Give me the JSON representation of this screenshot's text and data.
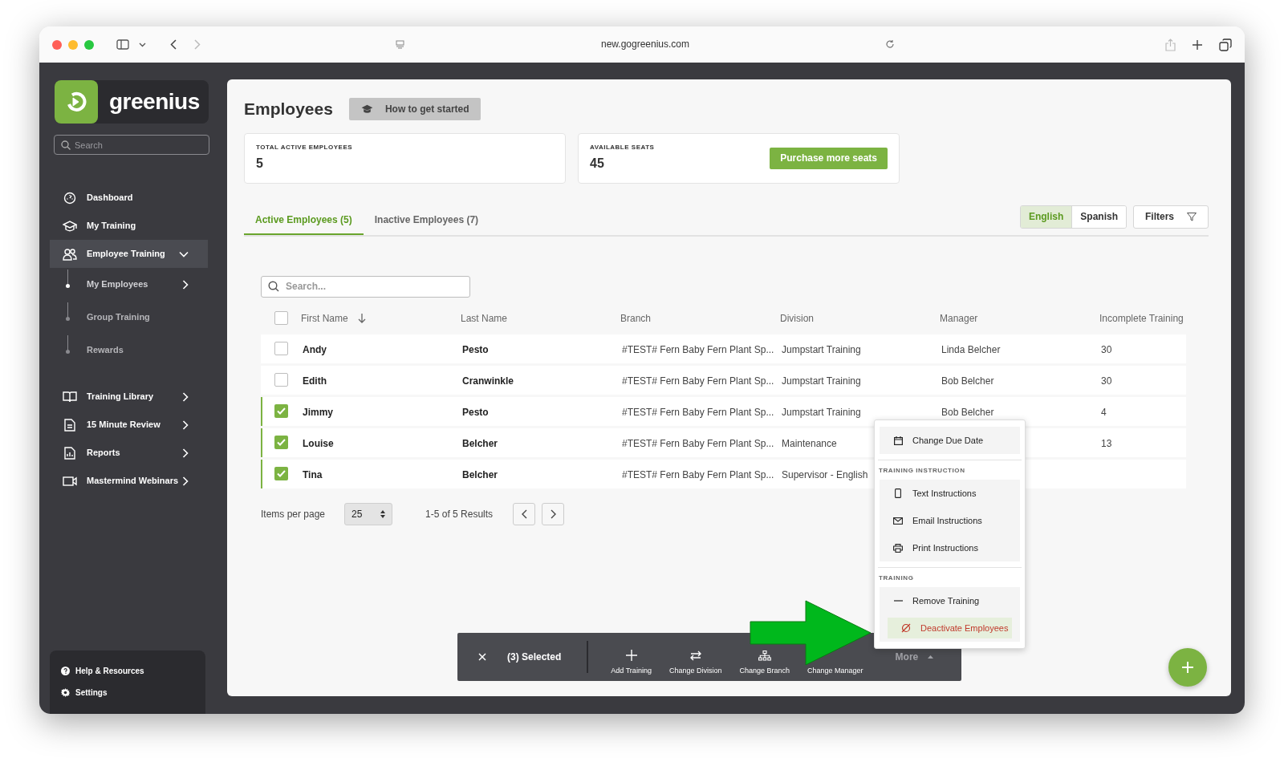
{
  "browser": {
    "url": "new.gogreenius.com"
  },
  "sidebar": {
    "brand": "greenius",
    "search_placeholder": "Search",
    "nav": [
      {
        "label": "Dashboard",
        "selected": false
      },
      {
        "label": "My Training",
        "selected": false
      },
      {
        "label": "Employee Training",
        "selected": true,
        "expanded": true,
        "children": [
          {
            "label": "My Employees",
            "selected": true
          },
          {
            "label": "Group Training",
            "selected": false
          },
          {
            "label": "Rewards",
            "selected": false
          }
        ]
      },
      {
        "label": "Training Library",
        "selected": false,
        "expanded": false
      },
      {
        "label": "15 Minute Review",
        "selected": false,
        "expanded": false
      },
      {
        "label": "Reports",
        "selected": false,
        "expanded": false
      },
      {
        "label": "Mastermind Webinars",
        "selected": false,
        "expanded": false
      }
    ],
    "footer": [
      "Help & Resources",
      "Settings"
    ]
  },
  "page": {
    "title": "Employees",
    "help_button": "How to get started",
    "stats": [
      {
        "label": "TOTAL ACTIVE EMPLOYEES",
        "value": "5"
      },
      {
        "label": "AVAILABLE SEATS",
        "value": "45"
      }
    ],
    "purchase_button": "Purchase more seats",
    "tabs": [
      {
        "label": "Active Employees (5)",
        "selected": true
      },
      {
        "label": "Inactive Employees (7)",
        "selected": false
      }
    ],
    "languages": [
      {
        "label": "English",
        "selected": true
      },
      {
        "label": "Spanish",
        "selected": false
      }
    ],
    "filters_button": "Filters"
  },
  "table": {
    "search_placeholder": "Search...",
    "all_checked": false,
    "columns": [
      {
        "label": "First Name",
        "sorted": true
      },
      {
        "label": "Last Name",
        "sorted": false
      },
      {
        "label": "Branch",
        "sorted": false
      },
      {
        "label": "Division",
        "sorted": false
      },
      {
        "label": "Manager",
        "sorted": false
      },
      {
        "label": "Incomplete Training",
        "sorted": false
      }
    ],
    "rows": [
      {
        "checked": false,
        "cells": [
          "Andy",
          "Pesto",
          "#TEST# Fern Baby Fern Plant Sp...",
          "Jumpstart Training",
          "Linda Belcher",
          "30"
        ]
      },
      {
        "checked": false,
        "cells": [
          "Edith",
          "Cranwinkle",
          "#TEST# Fern Baby Fern Plant Sp...",
          "Jumpstart Training",
          "Bob Belcher",
          "30"
        ]
      },
      {
        "checked": true,
        "cells": [
          "Jimmy",
          "Pesto",
          "#TEST# Fern Baby Fern Plant Sp...",
          "Jumpstart Training",
          "Bob Belcher",
          "4"
        ]
      },
      {
        "checked": true,
        "cells": [
          "Louise",
          "Belcher",
          "#TEST# Fern Baby Fern Plant Sp...",
          "Maintenance",
          "",
          "13"
        ]
      },
      {
        "checked": true,
        "cells": [
          "Tina",
          "Belcher",
          "#TEST# Fern Baby Fern Plant Sp...",
          "Supervisor - English",
          "",
          ""
        ]
      }
    ]
  },
  "pagination": {
    "label": "Items per page",
    "per_page": "25",
    "range": "1-5 of 5 Results"
  },
  "menu": {
    "sections": [
      {
        "items": [
          {
            "label": "Change Due Date",
            "kind": "normal"
          }
        ]
      },
      {
        "heading": "TRAINING INSTRUCTION",
        "items": [
          {
            "label": "Text Instructions",
            "kind": "normal"
          },
          {
            "label": "Email Instructions",
            "kind": "normal"
          },
          {
            "label": "Print Instructions",
            "kind": "normal"
          }
        ]
      },
      {
        "heading": "TRAINING",
        "items": [
          {
            "label": "Remove Training",
            "kind": "normal"
          },
          {
            "label": "Deactivate Employees",
            "kind": "danger"
          }
        ]
      }
    ]
  },
  "action_bar": {
    "selected": "(3) Selected",
    "actions": [
      "Add Training",
      "Change Division",
      "Change Branch",
      "Change Manager"
    ],
    "more": "More"
  }
}
